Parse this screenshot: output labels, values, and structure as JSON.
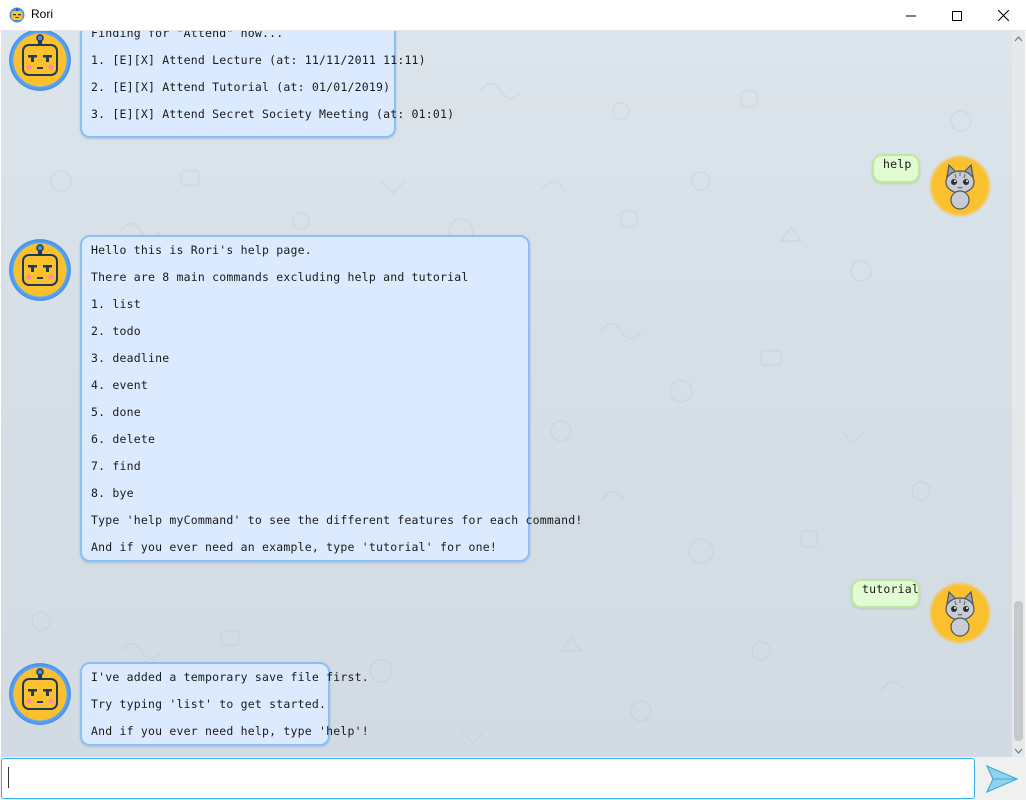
{
  "window": {
    "title": "Rori",
    "app_icon": "robot-icon",
    "controls": [
      "minimize-icon",
      "maximize-icon",
      "close-icon"
    ]
  },
  "colors": {
    "bot_bubble_bg": "#dbeaff",
    "bot_bubble_border": "#8cc0f5",
    "user_bubble_bg": "#e2fbd3",
    "avatar_ring": "#fbc02d",
    "input_focus": "#3daee9"
  },
  "messages": [
    {
      "sender": "bot",
      "avatar": "robot-avatar",
      "lines": [
        "Finding for \"Attend\" now...",
        "1. [E][X] Attend Lecture (at: 11/11/2011 11:11)",
        "2. [E][X] Attend Tutorial (at: 01/01/2019)",
        "3. [E][X] Attend Secret Society Meeting (at: 01:01)"
      ]
    },
    {
      "sender": "user",
      "avatar": "cat-avatar",
      "lines": [
        "help"
      ]
    },
    {
      "sender": "bot",
      "avatar": "robot-avatar",
      "lines": [
        "Hello this is Rori's help page.",
        "There are 8 main commands excluding help and tutorial",
        "1. list",
        "2. todo",
        "3. deadline",
        "4. event",
        "5. done",
        "6. delete",
        "7. find",
        "8. bye",
        "Type 'help myCommand' to see the different features for each command!",
        "And if you ever need an example, type 'tutorial' for one!"
      ]
    },
    {
      "sender": "user",
      "avatar": "cat-avatar",
      "lines": [
        "tutorial"
      ]
    },
    {
      "sender": "bot",
      "avatar": "robot-avatar",
      "lines": [
        "I've added a temporary save file first.",
        "Try typing 'list' to get started.",
        "And if you ever need help, type 'help'!"
      ]
    }
  ],
  "input": {
    "value": "",
    "placeholder": ""
  },
  "send_button": {
    "icon": "send-icon"
  }
}
